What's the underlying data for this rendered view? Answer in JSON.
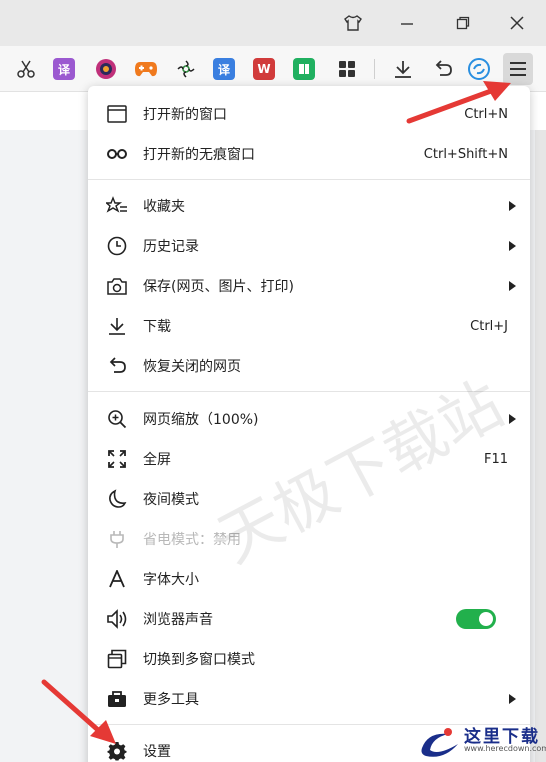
{
  "toolbar": {
    "icons": [
      {
        "name": "scissors-icon",
        "glyph": "✂",
        "color": "#333333"
      },
      {
        "name": "translate-icon",
        "glyph": "译",
        "color": "#9b59d0"
      },
      {
        "name": "camera-lens-icon",
        "glyph": "◉",
        "color": "#c0307a"
      },
      {
        "name": "gamepad-icon",
        "glyph": "🎮",
        "color": "#f07a1e"
      },
      {
        "name": "leaf-icon",
        "glyph": "✿",
        "color": "#2e8b3e"
      },
      {
        "name": "translate-blue-icon",
        "glyph": "译",
        "color": "#3a7fe0"
      },
      {
        "name": "document-w-icon",
        "glyph": "W",
        "color": "#d13b3b"
      },
      {
        "name": "book-icon",
        "glyph": "▣",
        "color": "#20b060"
      },
      {
        "name": "apps-grid-icon",
        "glyph": "▦",
        "color": "#333333"
      },
      {
        "name": "download-icon",
        "glyph": "⤓",
        "color": "#333333"
      },
      {
        "name": "undo-icon",
        "glyph": "↶",
        "color": "#333333"
      },
      {
        "name": "sync-icon",
        "glyph": "⟳",
        "color": "#2a8fe0"
      },
      {
        "name": "menu-icon",
        "glyph": "☰",
        "color": "#333333"
      }
    ]
  },
  "menu": {
    "items": [
      {
        "label": "打开新的窗口",
        "shortcut": "Ctrl+N",
        "icon": "window-icon"
      },
      {
        "label": "打开新的无痕窗口",
        "shortcut": "Ctrl+Shift+N",
        "icon": "incognito-icon"
      },
      {
        "label": "收藏夹",
        "shortcut": "",
        "icon": "star-list-icon"
      },
      {
        "label": "历史记录",
        "shortcut": "",
        "icon": "clock-icon"
      },
      {
        "label": "保存(网页、图片、打印)",
        "shortcut": "",
        "icon": "camera-icon"
      },
      {
        "label": "下载",
        "shortcut": "Ctrl+J",
        "icon": "download-icon"
      },
      {
        "label": "恢复关闭的网页",
        "shortcut": "",
        "icon": "undo-icon"
      },
      {
        "label": "网页缩放（100%)",
        "shortcut": "",
        "icon": "zoom-icon"
      },
      {
        "label": "全屏",
        "shortcut": "F11",
        "icon": "fullscreen-icon"
      },
      {
        "label": "夜间模式",
        "shortcut": "",
        "icon": "moon-icon"
      },
      {
        "label": "省电模式：禁用",
        "shortcut": "",
        "icon": "plug-icon"
      },
      {
        "label": "字体大小",
        "shortcut": "",
        "icon": "font-size-icon"
      },
      {
        "label": "浏览器声音",
        "shortcut": "",
        "icon": "speaker-icon"
      },
      {
        "label": "切换到多窗口模式",
        "shortcut": "",
        "icon": "multi-window-icon"
      },
      {
        "label": "更多工具",
        "shortcut": "",
        "icon": "toolbox-icon"
      },
      {
        "label": "设置",
        "shortcut": "",
        "icon": "gear-icon"
      }
    ],
    "sound_enabled": true
  },
  "watermark": "天极下载站",
  "logo": {
    "text": "这里下载",
    "url": "www.herecdown.com"
  },
  "colors": {
    "accent_red": "#e53935",
    "toggle_green": "#22b04c"
  }
}
